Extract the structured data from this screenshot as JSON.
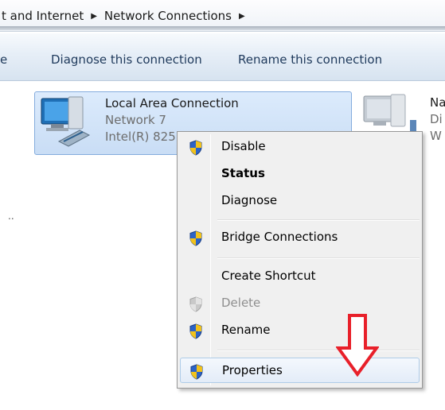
{
  "breadcrumb": {
    "items": [
      "t and Internet",
      "Network Connections"
    ]
  },
  "commandbar": {
    "partial_label": "e",
    "diagnose_label": "Diagnose this connection",
    "rename_label": "Rename this connection"
  },
  "connections": [
    {
      "name": "Local Area Connection",
      "network": "Network  7",
      "adapter": "Intel(R) 825",
      "selected": true
    },
    {
      "name": "Na",
      "line2": "Di",
      "line3": "W",
      "selected": false
    }
  ],
  "side_marker": "..",
  "context_menu": {
    "items": [
      {
        "label": "Disable",
        "icon": "uac-shield-icon",
        "style": "normal"
      },
      {
        "label": "Status",
        "icon": "",
        "style": "bold"
      },
      {
        "label": "Diagnose",
        "icon": "",
        "style": "normal"
      },
      {
        "label": "Bridge Connections",
        "icon": "uac-shield-icon",
        "style": "normal"
      },
      {
        "label": "Create Shortcut",
        "icon": "",
        "style": "normal"
      },
      {
        "label": "Delete",
        "icon": "uac-shield-icon",
        "style": "disabled"
      },
      {
        "label": "Rename",
        "icon": "uac-shield-icon",
        "style": "normal"
      },
      {
        "label": "Properties",
        "icon": "uac-shield-icon",
        "style": "hover"
      }
    ]
  },
  "annotation": {
    "icon": "red-down-arrow-icon",
    "color": "#e8202a"
  }
}
